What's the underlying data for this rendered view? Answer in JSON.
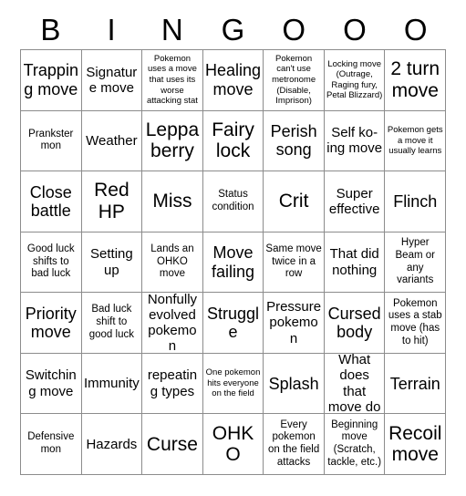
{
  "card": {
    "header_letters": [
      "B",
      "I",
      "N",
      "G",
      "O",
      "O",
      "O"
    ],
    "columns": 7,
    "rows": 7,
    "grid_line_color": "#8c8c8c",
    "background_color": "#ffffff",
    "text_color": "#000000",
    "cells": [
      [
        {
          "text": "Trapping move",
          "size": "lg"
        },
        {
          "text": "Signature move",
          "size": "md"
        },
        {
          "text": "Pokemon uses a move that uses its worse attacking stat",
          "size": "xs"
        },
        {
          "text": "Healing move",
          "size": "lg"
        },
        {
          "text": "Pokemon can't use metronome (Disable, Imprison)",
          "size": "xs"
        },
        {
          "text": "Locking move (Outrage, Raging fury, Petal Blizzard)",
          "size": "xs"
        },
        {
          "text": "2 turn move",
          "size": "xl"
        }
      ],
      [
        {
          "text": "Prankster mon",
          "size": "sm"
        },
        {
          "text": "Weather",
          "size": "md"
        },
        {
          "text": "Leppa berry",
          "size": "xl"
        },
        {
          "text": "Fairy lock",
          "size": "xl"
        },
        {
          "text": "Perish song",
          "size": "lg"
        },
        {
          "text": "Self ko-ing move",
          "size": "md"
        },
        {
          "text": "Pokemon gets a move it usually learns",
          "size": "xs"
        }
      ],
      [
        {
          "text": "Close battle",
          "size": "lg"
        },
        {
          "text": "Red HP",
          "size": "xl"
        },
        {
          "text": "Miss",
          "size": "xl"
        },
        {
          "text": "Status condition",
          "size": "sm"
        },
        {
          "text": "Crit",
          "size": "xl"
        },
        {
          "text": "Super effective",
          "size": "md"
        },
        {
          "text": "Flinch",
          "size": "lg"
        }
      ],
      [
        {
          "text": "Good luck shifts to bad luck",
          "size": "sm"
        },
        {
          "text": "Setting up",
          "size": "md"
        },
        {
          "text": "Lands an OHKO move",
          "size": "sm"
        },
        {
          "text": "Move failing",
          "size": "lg"
        },
        {
          "text": "Same move twice in a row",
          "size": "sm"
        },
        {
          "text": "That did nothing",
          "size": "md"
        },
        {
          "text": "Hyper Beam or any variants",
          "size": "sm"
        }
      ],
      [
        {
          "text": "Priority move",
          "size": "lg"
        },
        {
          "text": "Bad luck shift to good luck",
          "size": "sm"
        },
        {
          "text": "Nonfully evolved pokemon",
          "size": "md"
        },
        {
          "text": "Struggle",
          "size": "lg"
        },
        {
          "text": "Pressure pokemon",
          "size": "md"
        },
        {
          "text": "Cursed body",
          "size": "lg"
        },
        {
          "text": "Pokemon uses a stab move (has to hit)",
          "size": "sm"
        }
      ],
      [
        {
          "text": "Switching move",
          "size": "md"
        },
        {
          "text": "Immunity",
          "size": "md"
        },
        {
          "text": "repeating types",
          "size": "md"
        },
        {
          "text": "One pokemon hits everyone on the field",
          "size": "xs"
        },
        {
          "text": "Splash",
          "size": "lg"
        },
        {
          "text": "What does that move do",
          "size": "md"
        },
        {
          "text": "Terrain",
          "size": "lg"
        }
      ],
      [
        {
          "text": "Defensive mon",
          "size": "sm"
        },
        {
          "text": "Hazards",
          "size": "md"
        },
        {
          "text": "Curse",
          "size": "xl"
        },
        {
          "text": "OHKO",
          "size": "xl"
        },
        {
          "text": "Every pokemon on the field attacks",
          "size": "sm"
        },
        {
          "text": "Beginning move (Scratch, tackle, etc.)",
          "size": "sm"
        },
        {
          "text": "Recoil move",
          "size": "xl"
        }
      ]
    ]
  }
}
